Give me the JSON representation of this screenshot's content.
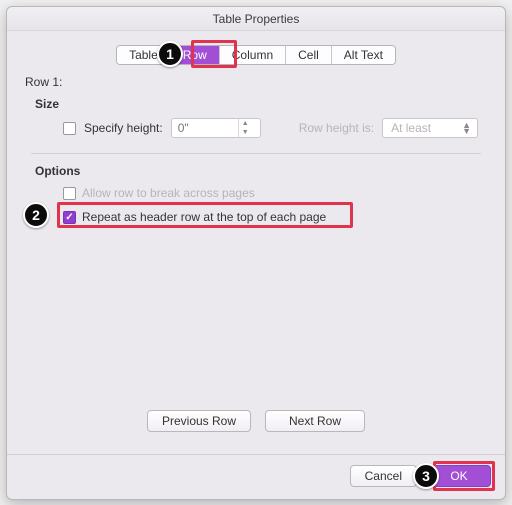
{
  "title": "Table Properties",
  "tabs": {
    "table": "Table",
    "row": "Row",
    "column": "Column",
    "cell": "Cell",
    "alttext": "Alt Text"
  },
  "row_label": "Row 1:",
  "size": {
    "title": "Size",
    "specify_height": "Specify height:",
    "height_value": "0\"",
    "row_height_is": "Row height is:",
    "atleast": "At least"
  },
  "options": {
    "title": "Options",
    "allow_break": "Allow row to break across pages",
    "repeat_header": "Repeat as header row at the top of each page"
  },
  "nav": {
    "previous": "Previous Row",
    "next": "Next Row"
  },
  "footer": {
    "cancel": "Cancel",
    "ok": "OK"
  },
  "callouts": {
    "one": "1",
    "two": "2",
    "three": "3"
  }
}
